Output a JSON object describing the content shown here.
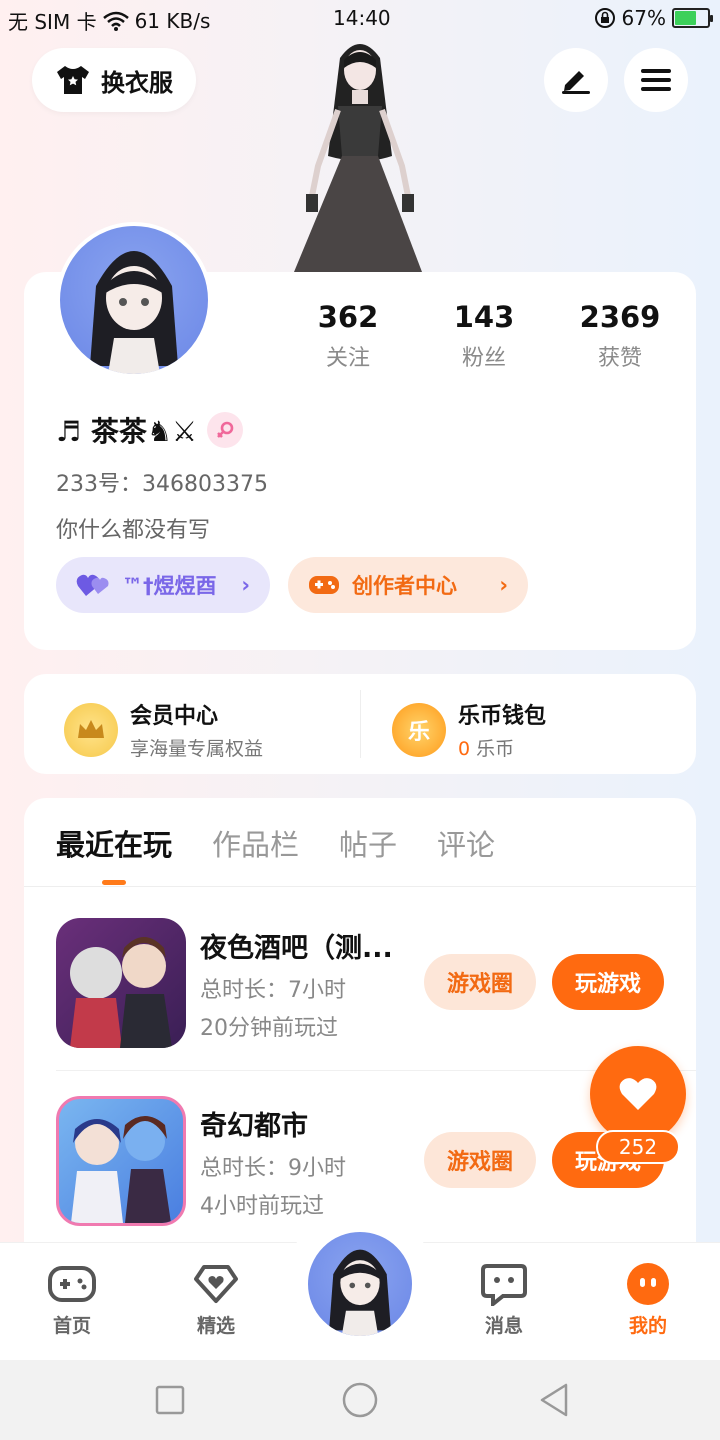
{
  "status_bar": {
    "carrier": "无 SIM 卡",
    "speed": "61 KB/s",
    "time": "14:40",
    "battery": "67%",
    "battery_level": 0.67
  },
  "header": {
    "outfit_label": "换衣服",
    "edit_icon": "pen-icon",
    "menu_icon": "menu-icon"
  },
  "profile": {
    "stats": [
      {
        "value": "362",
        "label": "关注"
      },
      {
        "value": "143",
        "label": "粉丝"
      },
      {
        "value": "2369",
        "label": "获赞"
      }
    ],
    "nickname": "♬ 茶茶♞⚔",
    "uid_label": "233号：346803375",
    "bio": "你什么都没有写",
    "pill_purple": "™†煜煜酉",
    "pill_orange": "创作者中心"
  },
  "vip": {
    "member_title": "会员中心",
    "member_sub": "享海量专属权益",
    "wallet_title": "乐币钱包",
    "wallet_amount": "0",
    "wallet_unit": "乐币",
    "coin_char": "乐"
  },
  "recent": {
    "tabs": [
      "最近在玩",
      "作品栏",
      "帖子",
      "评论"
    ],
    "games": [
      {
        "title": "夜色酒吧（测...",
        "duration": "总时长：7小时",
        "last_played": "20分钟前玩过",
        "circle_label": "游戏圈",
        "play_label": "玩游戏"
      },
      {
        "title": "奇幻都市",
        "duration": "总时长：9小时",
        "last_played": "4小时前玩过",
        "circle_label": "游戏圈",
        "play_label": "玩游戏"
      }
    ]
  },
  "floating_like": {
    "count": "252"
  },
  "bottom_nav": {
    "items": [
      {
        "label": "首页"
      },
      {
        "label": "精选"
      },
      {
        "label": "消息"
      },
      {
        "label": "我的"
      }
    ]
  },
  "colors": {
    "accent_orange": "#ff6a10",
    "accent_purple": "#7a67e8",
    "gold": "#f6c84a"
  }
}
